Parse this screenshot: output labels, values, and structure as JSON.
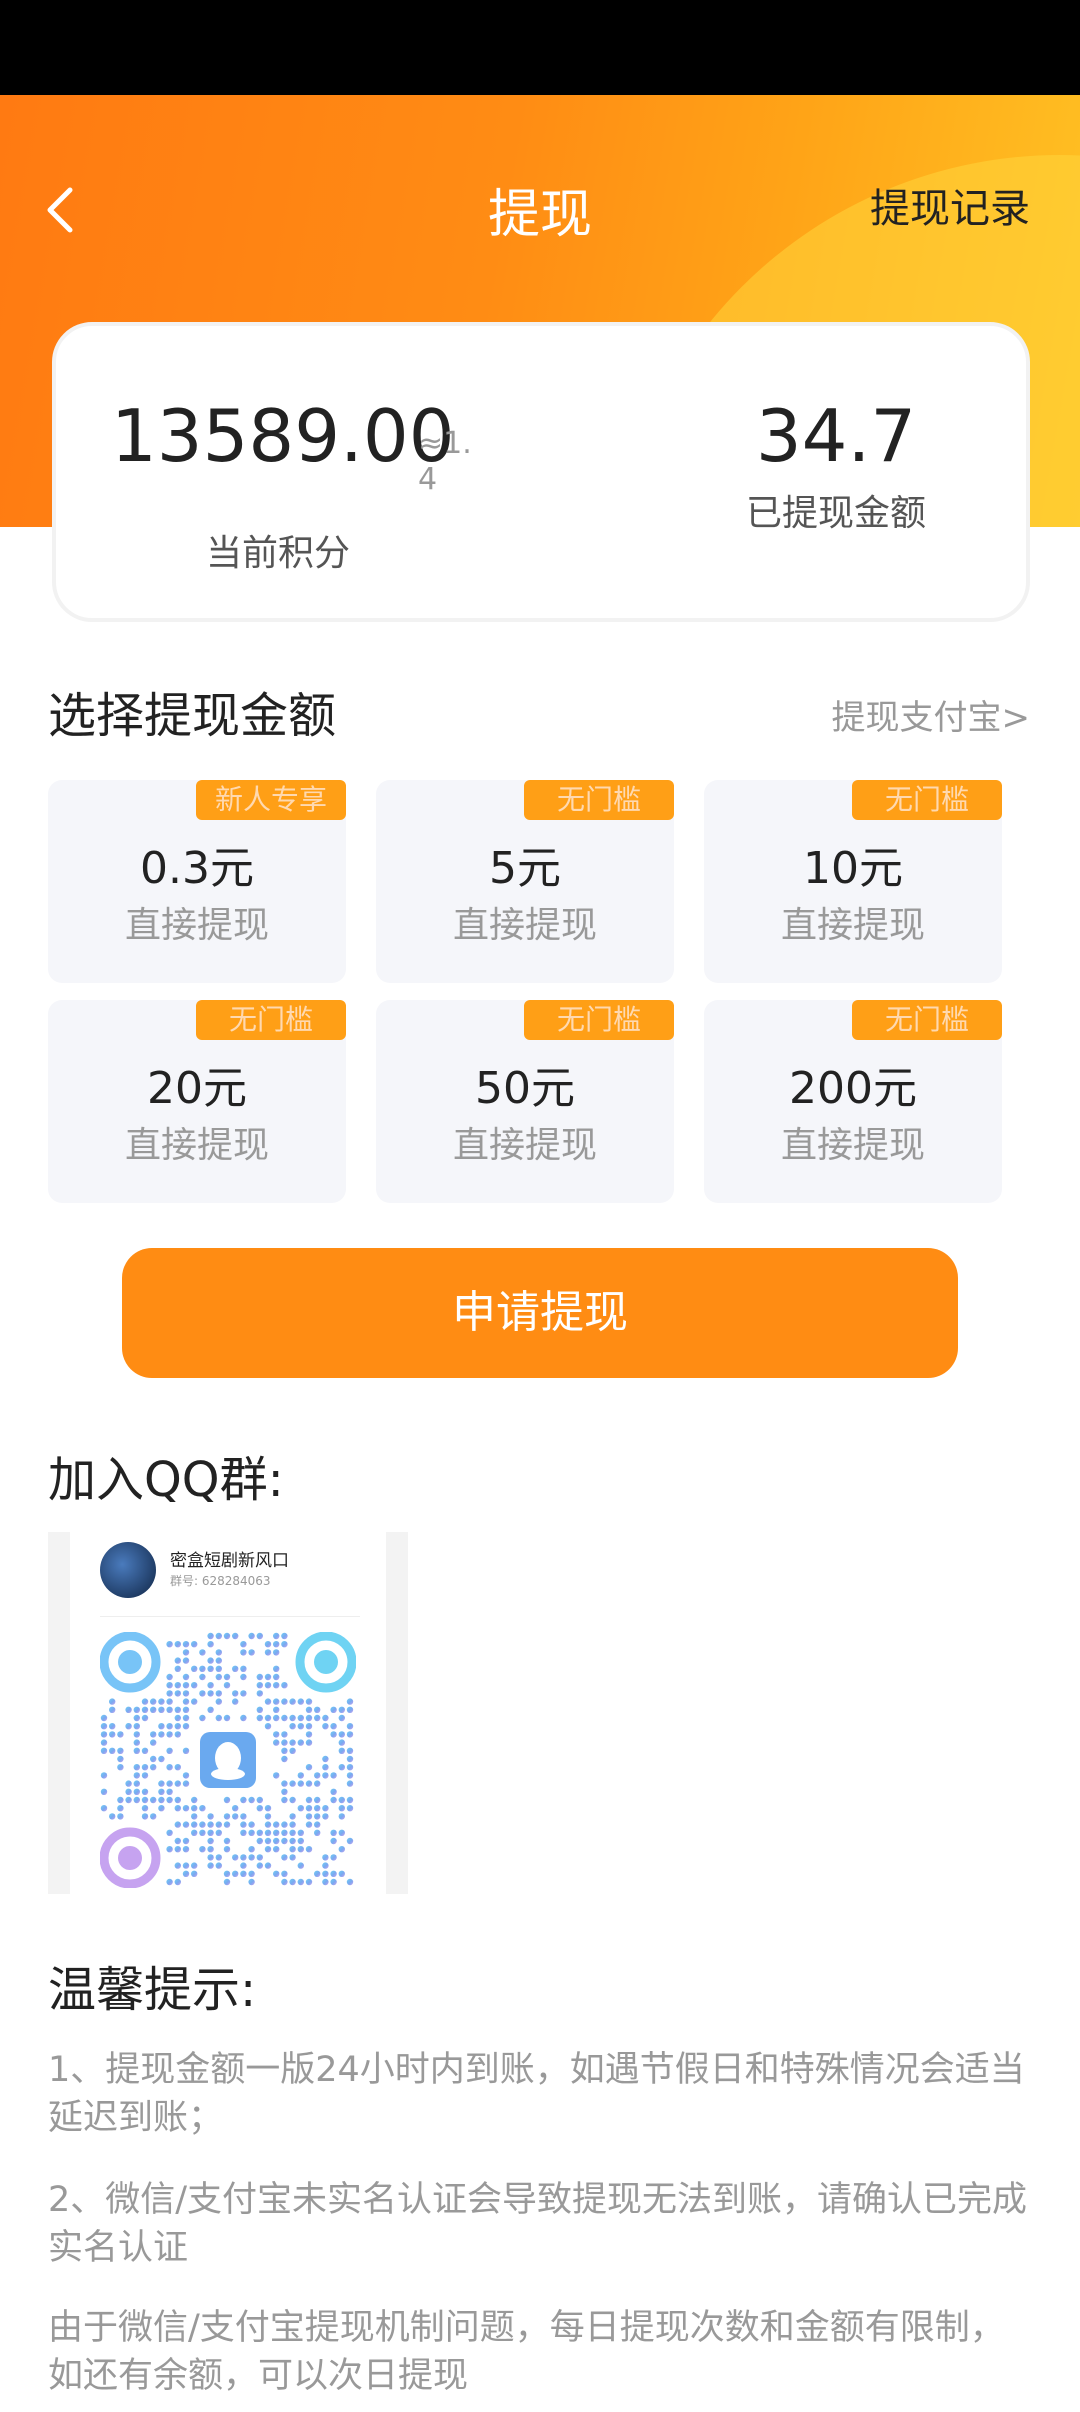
{
  "header": {
    "title": "提现",
    "record_link": "提现记录"
  },
  "summary": {
    "points_value": "13589.00",
    "points_approx": "≈1.4",
    "points_label": "当前积分",
    "withdrawn_value": "34.7",
    "withdrawn_label": "已提现金额"
  },
  "select": {
    "title": "选择提现金额",
    "alipay_link": "提现支付宝>"
  },
  "amounts": [
    {
      "tag": "新人专享",
      "value": "0.3元",
      "desc": "直接提现"
    },
    {
      "tag": "无门槛",
      "value": "5元",
      "desc": "直接提现"
    },
    {
      "tag": "无门槛",
      "value": "10元",
      "desc": "直接提现"
    },
    {
      "tag": "无门槛",
      "value": "20元",
      "desc": "直接提现"
    },
    {
      "tag": "无门槛",
      "value": "50元",
      "desc": "直接提现"
    },
    {
      "tag": "无门槛",
      "value": "200元",
      "desc": "直接提现"
    }
  ],
  "apply_button": "申请提现",
  "qq": {
    "title": "加入QQ群:",
    "group_name": "密盒短剧新风口",
    "group_id": "群号: 628284063"
  },
  "tips": {
    "title": "温馨提示:",
    "items": [
      "1、提现金额一版24小时内到账，如遇节假日和特殊情况会适当延迟到账；",
      "2、微信/支付宝未实名认证会导致提现无法到账，请确认已完成实名认证",
      "由于微信/支付宝提现机制问题，每日提现次数和金额有限制，如还有余额，可以次日提现"
    ]
  },
  "colors": {
    "accent": "#ff8c13",
    "tag_bg": "#ff9f16",
    "tag_text": "#ffd9b0",
    "card_bg": "#f5f6fa"
  }
}
